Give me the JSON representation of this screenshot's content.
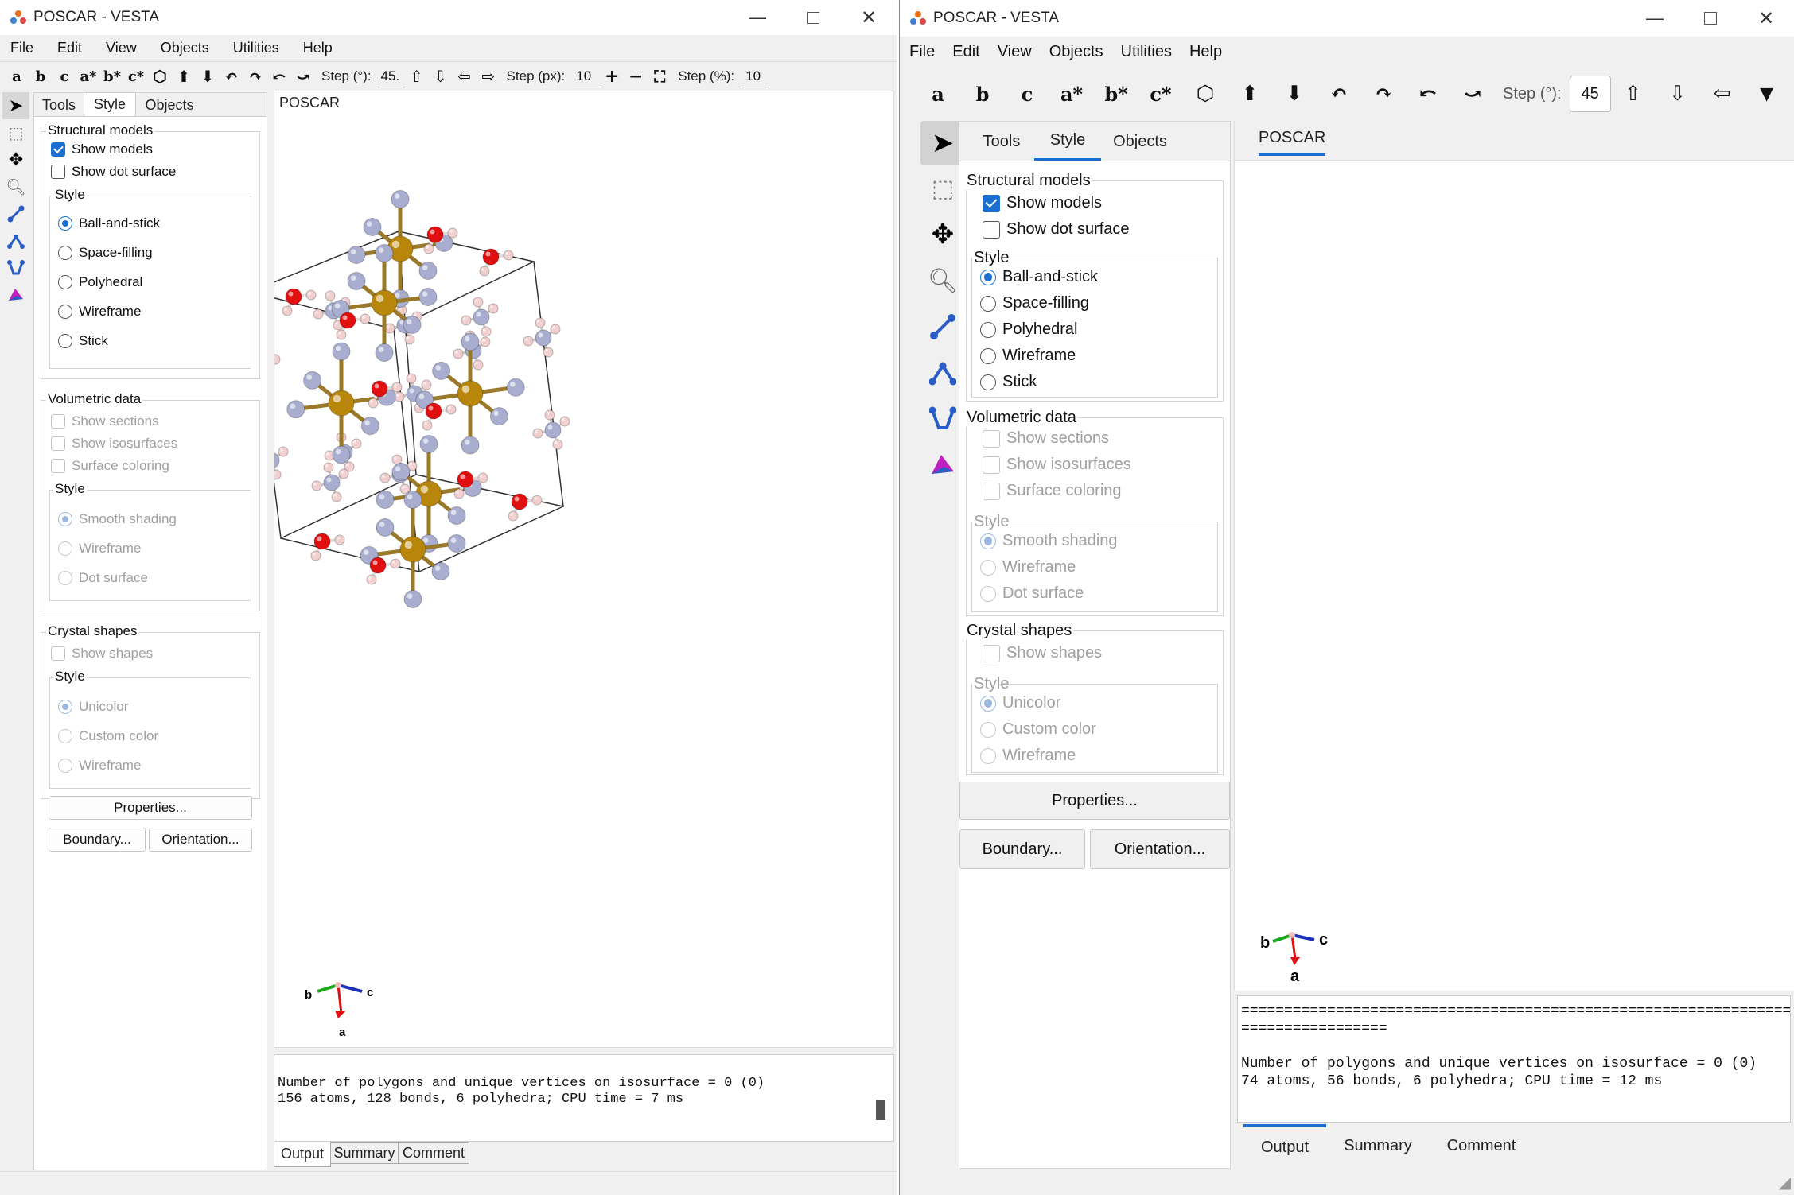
{
  "left_window": {
    "title": "POSCAR - VESTA",
    "menu": [
      "File",
      "Edit",
      "View",
      "Objects",
      "Utilities",
      "Help"
    ],
    "toolbar": {
      "axes": [
        "a",
        "b",
        "c",
        "a*",
        "b*",
        "c*"
      ],
      "step_deg_label": "Step (°):",
      "step_deg_value": "45.",
      "step_px_label": "Step (px):",
      "step_px_value": "10",
      "step_pct_label": "Step (%):",
      "step_pct_value": "10"
    },
    "tabs": [
      "Tools",
      "Style",
      "Objects"
    ],
    "structural": {
      "title": "Structural models",
      "show_models": "Show models",
      "show_dot_surface": "Show dot surface",
      "style_title": "Style",
      "styles": [
        "Ball-and-stick",
        "Space-filling",
        "Polyhedral",
        "Wireframe",
        "Stick"
      ]
    },
    "volumetric": {
      "title": "Volumetric data",
      "options": [
        "Show sections",
        "Show isosurfaces",
        "Surface coloring"
      ],
      "style_title": "Style",
      "styles": [
        "Smooth shading",
        "Wireframe",
        "Dot surface"
      ]
    },
    "crystal": {
      "title": "Crystal shapes",
      "show_shapes": "Show shapes",
      "style_title": "Style",
      "styles": [
        "Unicolor",
        "Custom color",
        "Wireframe"
      ]
    },
    "buttons": {
      "properties": "Properties...",
      "boundary": "Boundary...",
      "orientation": "Orientation..."
    },
    "view_tab": "POSCAR",
    "axes_labels": {
      "a": "a",
      "b": "b",
      "c": "c"
    },
    "console_lines": [
      "Number of polygons and unique vertices on isosurface = 0 (0)",
      "156 atoms, 128 bonds, 6 polyhedra; CPU time = 7 ms"
    ],
    "console_tabs": [
      "Output",
      "Summary",
      "Comment"
    ]
  },
  "right_window": {
    "title": "POSCAR - VESTA",
    "menu": [
      "File",
      "Edit",
      "View",
      "Objects",
      "Utilities",
      "Help"
    ],
    "toolbar": {
      "axes": [
        "a",
        "b",
        "c",
        "a*",
        "b*",
        "c*"
      ],
      "step_deg_label": "Step (°):",
      "step_deg_value": "45"
    },
    "tabs": [
      "Tools",
      "Style",
      "Objects"
    ],
    "structural": {
      "title": "Structural models",
      "show_models": "Show models",
      "show_dot_surface": "Show dot surface",
      "style_title": "Style",
      "styles": [
        "Ball-and-stick",
        "Space-filling",
        "Polyhedral",
        "Wireframe",
        "Stick"
      ]
    },
    "volumetric": {
      "title": "Volumetric data",
      "options": [
        "Show sections",
        "Show isosurfaces",
        "Surface coloring"
      ],
      "style_title": "Style",
      "styles": [
        "Smooth shading",
        "Wireframe",
        "Dot surface"
      ]
    },
    "crystal": {
      "title": "Crystal shapes",
      "show_shapes": "Show shapes",
      "style_title": "Style",
      "styles": [
        "Unicolor",
        "Custom color",
        "Wireframe"
      ]
    },
    "buttons": {
      "properties": "Properties...",
      "boundary": "Boundary...",
      "orientation": "Orientation..."
    },
    "view_tab": "POSCAR",
    "axes_labels": {
      "a": "a",
      "b": "b",
      "c": "c"
    },
    "console_lines": [
      "========================================================================",
      "=================",
      "",
      "Number of polygons and unique vertices on isosurface = 0 (0)",
      "74 atoms, 56 bonds, 6 polyhedra; CPU time = 12 ms"
    ],
    "console_tabs": [
      "Output",
      "Summary",
      "Comment"
    ]
  },
  "colors": {
    "metal": "#b8860b",
    "nitrogen": "#a9aed0",
    "oxygen": "#e01010",
    "hydrogen": "#f2d0d0",
    "accent": "#1a6fd1"
  }
}
